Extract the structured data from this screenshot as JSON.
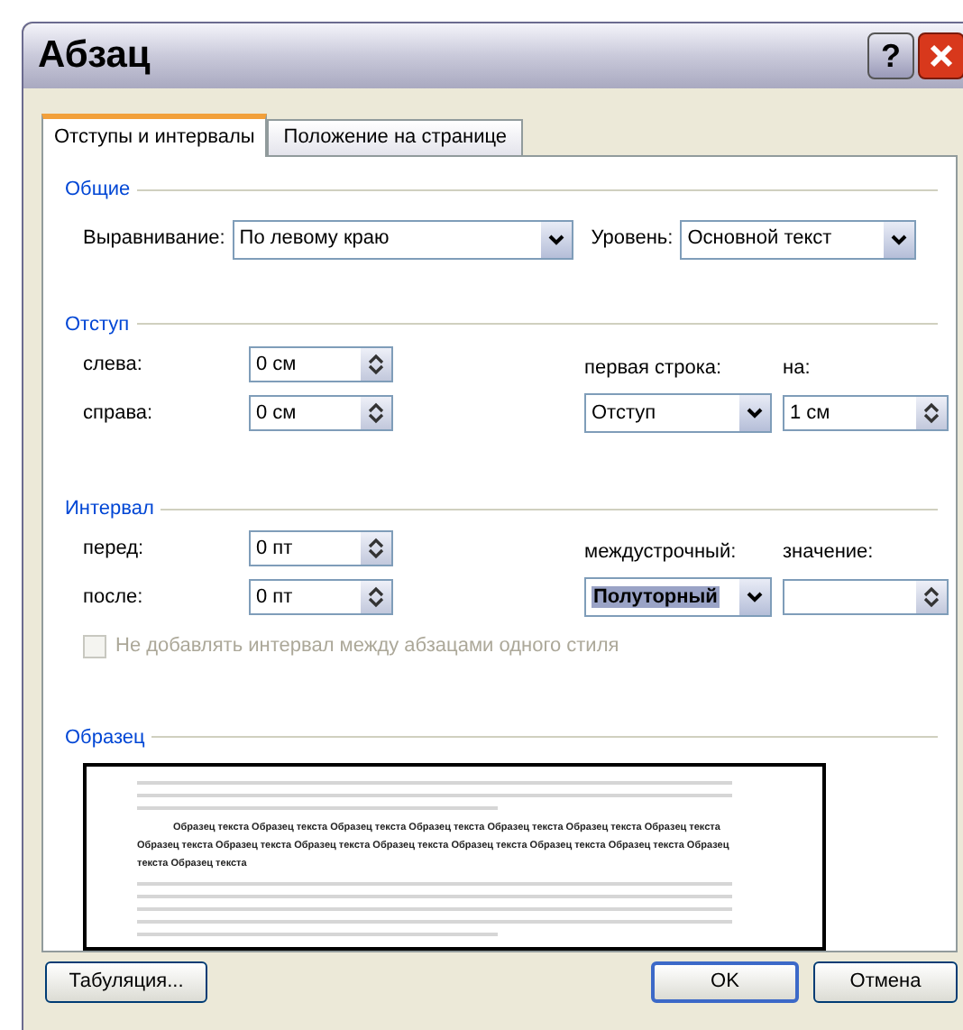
{
  "window": {
    "title": "Абзац",
    "help_label": "?"
  },
  "tabs": [
    {
      "label": "Отступы и интервалы",
      "selected": true
    },
    {
      "label": "Положение на странице",
      "selected": false
    }
  ],
  "general": {
    "title": "Общие",
    "alignment": {
      "label": "Выравнивание:",
      "value": "По левому краю"
    },
    "level": {
      "label": "Уровень:",
      "value": "Основной текст"
    }
  },
  "indent": {
    "title": "Отступ",
    "left": {
      "label": "слева:",
      "value": "0 см"
    },
    "right": {
      "label": "справа:",
      "value": "0 см"
    },
    "first_line": {
      "label": "первая строка:",
      "value": "Отступ"
    },
    "by": {
      "label": "на:",
      "value": "1 см"
    }
  },
  "spacing": {
    "title": "Интервал",
    "before": {
      "label": "перед:",
      "value": "0 пт"
    },
    "after": {
      "label": "после:",
      "value": "0 пт"
    },
    "line_spacing": {
      "label": "междустрочный:",
      "value": "Полуторный",
      "highlighted": true
    },
    "at": {
      "label": "значение:"
    },
    "same_style": {
      "label": "Не добавлять интервал между абзацами одного стиля",
      "checked": false,
      "disabled": true
    }
  },
  "sample": {
    "title": "Образец",
    "text": "Образец текста Образец текста Образец текста Образец текста Образец текста Образец текста Образец текста Образец текста Образец текста Образец текста Образец текста Образец текста Образец текста Образец текста Образец текста Образец текста"
  },
  "buttons": [
    {
      "label": "Табуляция...",
      "default": false
    },
    {
      "label": "OK",
      "default": true
    },
    {
      "label": "Отмена",
      "default": false
    }
  ]
}
